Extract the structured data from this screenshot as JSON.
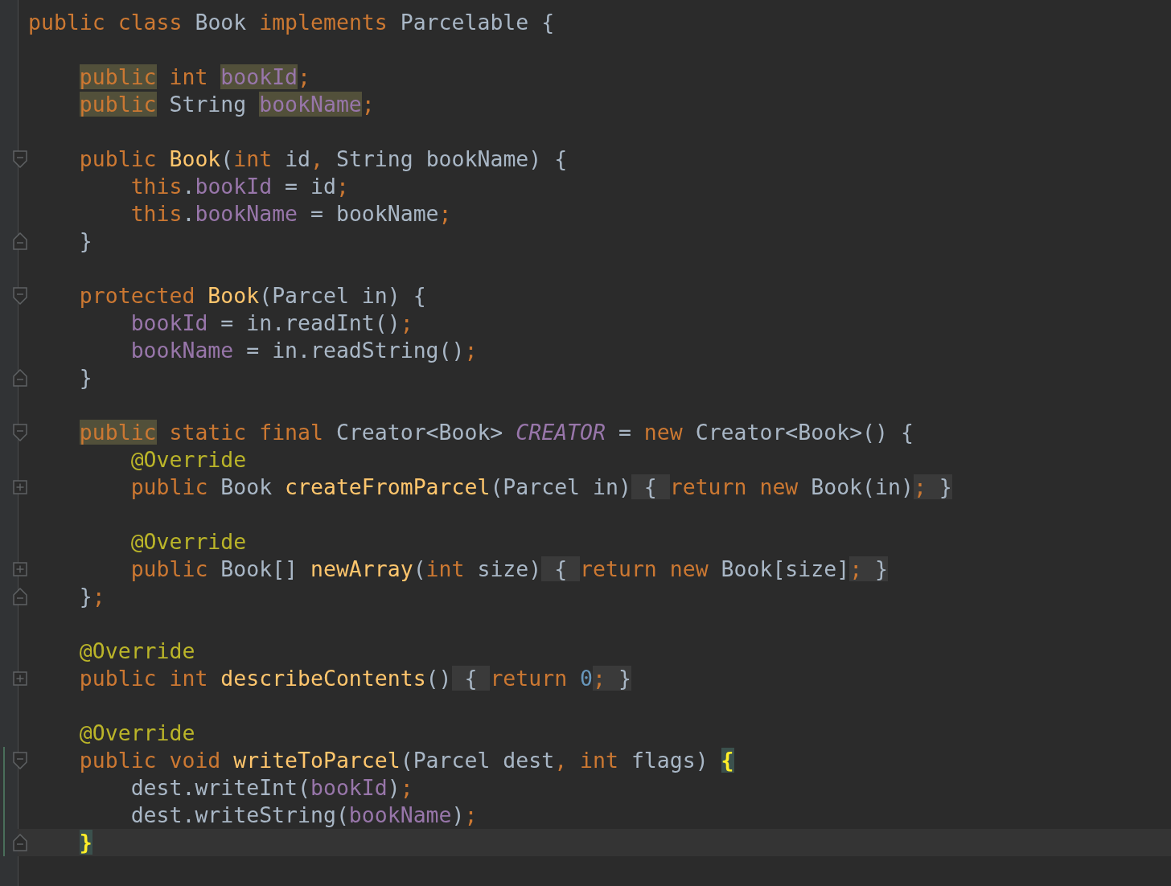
{
  "editor": {
    "lines": [
      {
        "kind": "code",
        "changed": false,
        "current": false,
        "tokens": [
          {
            "t": "public class ",
            "kind": "keyword"
          },
          {
            "t": "Book ",
            "kind": "plain"
          },
          {
            "t": "implements ",
            "kind": "keyword"
          },
          {
            "t": "Parcelable {",
            "kind": "plain"
          }
        ],
        "children": [
          {
            "kind": "blank",
            "changed": false,
            "current": false
          },
          {
            "kind": "code",
            "changed": false,
            "current": false,
            "tokens": [
              {
                "t": "public",
                "kind": "keyword-highlighted"
              },
              {
                "t": " int ",
                "kind": "keyword"
              },
              {
                "t": "bookId",
                "kind": "field-highlighted"
              },
              {
                "t": ";",
                "kind": "keyword"
              }
            ]
          },
          {
            "kind": "code",
            "changed": false,
            "current": false,
            "tokens": [
              {
                "t": "public",
                "kind": "keyword-highlighted"
              },
              {
                "t": " String ",
                "kind": "plain"
              },
              {
                "t": "bookName",
                "kind": "field-highlighted"
              },
              {
                "t": ";",
                "kind": "keyword"
              }
            ]
          },
          {
            "kind": "blank",
            "changed": false,
            "current": false
          },
          {
            "kind": "fold-start",
            "changed": false,
            "current": false,
            "tokens": [
              {
                "t": "public ",
                "kind": "keyword"
              },
              {
                "t": "Book",
                "kind": "method"
              },
              {
                "t": "(",
                "kind": "plain"
              },
              {
                "t": "int ",
                "kind": "keyword"
              },
              {
                "t": "id",
                "kind": "plain"
              },
              {
                "t": ", ",
                "kind": "keyword"
              },
              {
                "t": "String bookName) {",
                "kind": "plain"
              }
            ],
            "children": [
              {
                "kind": "code",
                "changed": false,
                "current": false,
                "tokens": [
                  {
                    "t": "this",
                    "kind": "keyword"
                  },
                  {
                    "t": ".",
                    "kind": "plain"
                  },
                  {
                    "t": "bookId",
                    "kind": "field"
                  },
                  {
                    "t": " = id",
                    "kind": "plain"
                  },
                  {
                    "t": ";",
                    "kind": "keyword"
                  }
                ]
              },
              {
                "kind": "code",
                "changed": false,
                "current": false,
                "tokens": [
                  {
                    "t": "this",
                    "kind": "keyword"
                  },
                  {
                    "t": ".",
                    "kind": "plain"
                  },
                  {
                    "t": "bookName",
                    "kind": "field"
                  },
                  {
                    "t": " = bookName",
                    "kind": "plain"
                  },
                  {
                    "t": ";",
                    "kind": "keyword"
                  }
                ]
              }
            ]
          },
          {
            "kind": "fold-end",
            "changed": false,
            "current": false,
            "tokens": [
              {
                "t": "}",
                "kind": "plain"
              }
            ]
          },
          {
            "kind": "blank",
            "changed": false,
            "current": false
          },
          {
            "kind": "fold-start",
            "changed": false,
            "current": false,
            "tokens": [
              {
                "t": "protected ",
                "kind": "keyword"
              },
              {
                "t": "Book",
                "kind": "method"
              },
              {
                "t": "(Parcel in) {",
                "kind": "plain"
              }
            ],
            "children": [
              {
                "kind": "code",
                "changed": false,
                "current": false,
                "tokens": [
                  {
                    "t": "bookId",
                    "kind": "field"
                  },
                  {
                    "t": " = in.readInt()",
                    "kind": "plain"
                  },
                  {
                    "t": ";",
                    "kind": "keyword"
                  }
                ]
              },
              {
                "kind": "code",
                "changed": false,
                "current": false,
                "tokens": [
                  {
                    "t": "bookName",
                    "kind": "field"
                  },
                  {
                    "t": " = in.readString()",
                    "kind": "plain"
                  },
                  {
                    "t": ";",
                    "kind": "keyword"
                  }
                ]
              }
            ]
          },
          {
            "kind": "fold-end",
            "changed": false,
            "current": false,
            "tokens": [
              {
                "t": "}",
                "kind": "plain"
              }
            ]
          },
          {
            "kind": "blank",
            "changed": false,
            "current": false
          },
          {
            "kind": "fold-start",
            "changed": false,
            "current": false,
            "tokens": [
              {
                "t": "public",
                "kind": "keyword-highlighted"
              },
              {
                "t": " static final ",
                "kind": "keyword"
              },
              {
                "t": "Creator<Book> ",
                "kind": "plain"
              },
              {
                "t": "CREATOR",
                "kind": "constant"
              },
              {
                "t": " = ",
                "kind": "plain"
              },
              {
                "t": "new ",
                "kind": "keyword"
              },
              {
                "t": "Creator<Book>() {",
                "kind": "plain"
              }
            ],
            "children": [
              {
                "kind": "code",
                "changed": false,
                "current": false,
                "tokens": [
                  {
                    "t": "@Override",
                    "kind": "annotation"
                  }
                ]
              },
              {
                "kind": "collapsed",
                "changed": false,
                "current": false,
                "tokens": [
                  {
                    "t": "public ",
                    "kind": "keyword"
                  },
                  {
                    "t": "Book ",
                    "kind": "plain"
                  },
                  {
                    "t": "createFromParcel",
                    "kind": "method"
                  },
                  {
                    "t": "(Parcel in)",
                    "kind": "plain"
                  },
                  {
                    "t": " { ",
                    "kind": "plain-folded"
                  },
                  {
                    "t": "return new ",
                    "kind": "keyword"
                  },
                  {
                    "t": "Book(in)",
                    "kind": "plain"
                  },
                  {
                    "t": "; ",
                    "kind": "keyword-folded"
                  },
                  {
                    "t": "}",
                    "kind": "plain-folded"
                  }
                ]
              },
              {
                "kind": "blank",
                "changed": false,
                "current": false
              },
              {
                "kind": "code",
                "changed": false,
                "current": false,
                "tokens": [
                  {
                    "t": "@Override",
                    "kind": "annotation"
                  }
                ]
              },
              {
                "kind": "collapsed",
                "changed": false,
                "current": false,
                "tokens": [
                  {
                    "t": "public ",
                    "kind": "keyword"
                  },
                  {
                    "t": "Book[] ",
                    "kind": "plain"
                  },
                  {
                    "t": "newArray",
                    "kind": "method"
                  },
                  {
                    "t": "(",
                    "kind": "plain"
                  },
                  {
                    "t": "int ",
                    "kind": "keyword"
                  },
                  {
                    "t": "size)",
                    "kind": "plain"
                  },
                  {
                    "t": " { ",
                    "kind": "plain-folded"
                  },
                  {
                    "t": "return new ",
                    "kind": "keyword"
                  },
                  {
                    "t": "Book[size]",
                    "kind": "plain"
                  },
                  {
                    "t": "; ",
                    "kind": "keyword-folded"
                  },
                  {
                    "t": "}",
                    "kind": "plain-folded"
                  }
                ]
              }
            ]
          },
          {
            "kind": "fold-end",
            "changed": false,
            "current": false,
            "tokens": [
              {
                "t": "}",
                "kind": "plain"
              },
              {
                "t": ";",
                "kind": "keyword"
              }
            ]
          },
          {
            "kind": "blank",
            "changed": false,
            "current": false
          },
          {
            "kind": "code",
            "changed": false,
            "current": false,
            "tokens": [
              {
                "t": "@Override",
                "kind": "annotation"
              }
            ]
          },
          {
            "kind": "collapsed",
            "changed": false,
            "current": false,
            "tokens": [
              {
                "t": "public int ",
                "kind": "keyword"
              },
              {
                "t": "describeContents",
                "kind": "method"
              },
              {
                "t": "()",
                "kind": "plain"
              },
              {
                "t": " { ",
                "kind": "plain-folded"
              },
              {
                "t": "return ",
                "kind": "keyword"
              },
              {
                "t": "0",
                "kind": "number"
              },
              {
                "t": "; ",
                "kind": "keyword-folded"
              },
              {
                "t": "}",
                "kind": "plain-folded"
              }
            ]
          },
          {
            "kind": "blank",
            "changed": false,
            "current": false
          },
          {
            "kind": "code",
            "changed": false,
            "current": false,
            "tokens": [
              {
                "t": "@Override",
                "kind": "annotation"
              }
            ]
          },
          {
            "kind": "fold-start",
            "changed": true,
            "current": false,
            "tokens": [
              {
                "t": "public void ",
                "kind": "keyword"
              },
              {
                "t": "writeToParcel",
                "kind": "method"
              },
              {
                "t": "(Parcel dest",
                "kind": "plain"
              },
              {
                "t": ", int ",
                "kind": "keyword"
              },
              {
                "t": "flags) ",
                "kind": "plain"
              },
              {
                "t": "{",
                "kind": "brace-matched"
              }
            ],
            "children": [
              {
                "kind": "code",
                "changed": true,
                "current": false,
                "tokens": [
                  {
                    "t": "dest.writeInt(",
                    "kind": "plain"
                  },
                  {
                    "t": "bookId",
                    "kind": "field"
                  },
                  {
                    "t": ")",
                    "kind": "plain"
                  },
                  {
                    "t": ";",
                    "kind": "keyword"
                  }
                ]
              },
              {
                "kind": "code",
                "changed": true,
                "current": false,
                "tokens": [
                  {
                    "t": "dest.writeString(",
                    "kind": "plain"
                  },
                  {
                    "t": "bookName",
                    "kind": "field"
                  },
                  {
                    "t": ")",
                    "kind": "plain"
                  },
                  {
                    "t": ";",
                    "kind": "keyword"
                  }
                ]
              }
            ]
          },
          {
            "kind": "fold-end",
            "changed": true,
            "current": true,
            "tokens": [
              {
                "t": "}",
                "kind": "brace-matched"
              }
            ]
          }
        ]
      }
    ]
  }
}
